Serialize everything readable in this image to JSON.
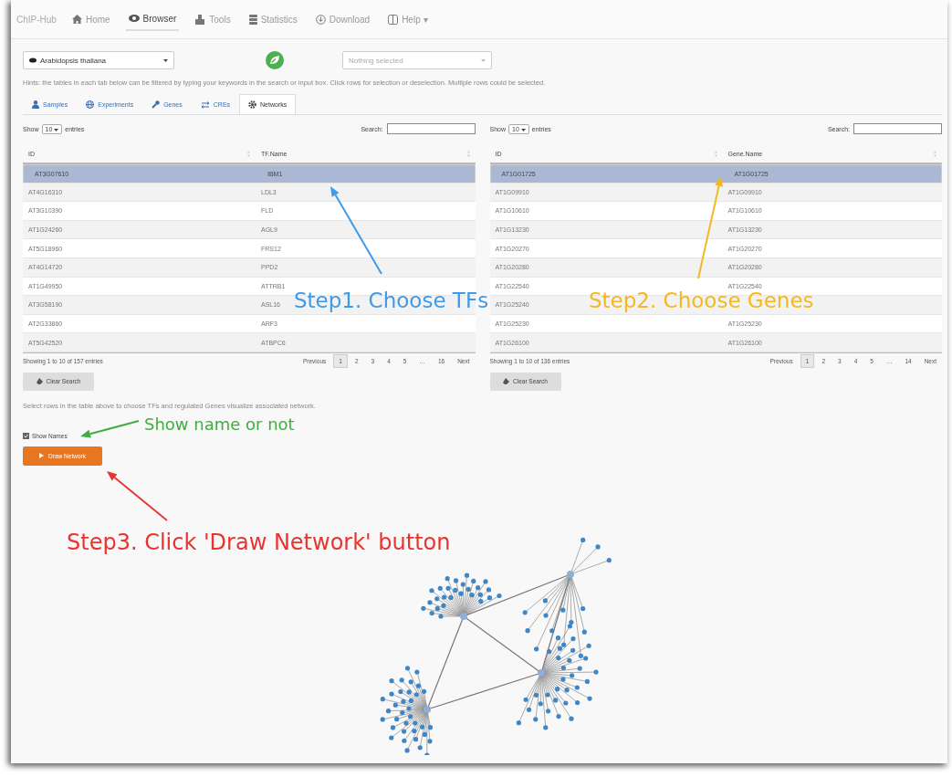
{
  "nav": {
    "brand": "ChIP-Hub",
    "items": [
      {
        "label": "Home",
        "selected": false
      },
      {
        "label": "Browser",
        "selected": true
      },
      {
        "label": "Tools",
        "selected": false
      },
      {
        "label": "Statistics",
        "selected": false
      },
      {
        "label": "Download",
        "selected": false
      },
      {
        "label": "Help",
        "selected": false,
        "caret": "▾"
      }
    ]
  },
  "species_select": {
    "value": "Arabidopsis thaliana"
  },
  "second_select": {
    "placeholder": "Nothing selected"
  },
  "hint": "Hints: the tables in each tab below can be filtered by typing your keywords in the search or input box. Click rows for selection or deselection. Multiple rows could be selected.",
  "tabs": [
    {
      "label": "Samples",
      "selected": false
    },
    {
      "label": "Experiments",
      "selected": false
    },
    {
      "label": "Genes",
      "selected": false
    },
    {
      "label": "CREs",
      "selected": false
    },
    {
      "label": "Networks",
      "selected": true
    }
  ],
  "tables": [
    {
      "show_label": "Show",
      "length": "10",
      "entries_label": "entries",
      "search_label": "Search:",
      "columns": [
        "ID",
        "TF.Name"
      ],
      "rows": [
        {
          "cells": [
            "AT3G07610",
            "IBM1"
          ],
          "selected": true
        },
        {
          "cells": [
            "AT4G16310",
            "LDL3"
          ],
          "selected": false
        },
        {
          "cells": [
            "AT3G10390",
            "FLD"
          ],
          "selected": false
        },
        {
          "cells": [
            "AT1G24260",
            "AGL9"
          ],
          "selected": false
        },
        {
          "cells": [
            "AT5G18960",
            "FRS12"
          ],
          "selected": false
        },
        {
          "cells": [
            "AT4G14720",
            "PPD2"
          ],
          "selected": false
        },
        {
          "cells": [
            "AT1G49950",
            "ATTRB1"
          ],
          "selected": false
        },
        {
          "cells": [
            "AT3G58190",
            "ASL16"
          ],
          "selected": false
        },
        {
          "cells": [
            "AT2G33860",
            "ARF3"
          ],
          "selected": false
        },
        {
          "cells": [
            "AT5G42520",
            "ATBPC6"
          ],
          "selected": false
        }
      ],
      "info": "Showing 1 to 10 of 157 entries",
      "previous": "Previous",
      "next": "Next",
      "pages": [
        {
          "label": "1",
          "selected": true
        },
        {
          "label": "2",
          "selected": false
        },
        {
          "label": "3",
          "selected": false
        },
        {
          "label": "4",
          "selected": false
        },
        {
          "label": "5",
          "selected": false
        },
        {
          "label": "…",
          "selected": false
        },
        {
          "label": "16",
          "selected": false
        }
      ],
      "clear_button": "Clear Search"
    },
    {
      "show_label": "Show",
      "length": "10",
      "entries_label": "entries",
      "search_label": "Search:",
      "columns": [
        "ID",
        "Gene.Name"
      ],
      "rows": [
        {
          "cells": [
            "AT1G01725",
            "AT1G01725"
          ],
          "selected": true
        },
        {
          "cells": [
            "AT1G09910",
            "AT1G09910"
          ],
          "selected": false
        },
        {
          "cells": [
            "AT1G10610",
            "AT1G10610"
          ],
          "selected": false
        },
        {
          "cells": [
            "AT1G13230",
            "AT1G13230"
          ],
          "selected": false
        },
        {
          "cells": [
            "AT1G20270",
            "AT1G20270"
          ],
          "selected": false
        },
        {
          "cells": [
            "AT1G20280",
            "AT1G20280"
          ],
          "selected": false
        },
        {
          "cells": [
            "AT1G22540",
            "AT1G22540"
          ],
          "selected": false
        },
        {
          "cells": [
            "AT1G25240"
          ],
          "selected": false
        },
        {
          "cells": [
            "AT1G25230",
            "AT1G25230"
          ],
          "selected": false
        },
        {
          "cells": [
            "AT1G26100",
            "AT1G26100"
          ],
          "selected": false
        }
      ],
      "info": "Showing 1 to 10 of 136 entries",
      "previous": "Previous",
      "next": "Next",
      "pages": [
        {
          "label": "1",
          "selected": true
        },
        {
          "label": "2",
          "selected": false
        },
        {
          "label": "3",
          "selected": false
        },
        {
          "label": "4",
          "selected": false
        },
        {
          "label": "5",
          "selected": false
        },
        {
          "label": "…",
          "selected": false
        },
        {
          "label": "14",
          "selected": false
        }
      ],
      "clear_button": "Clear Search"
    }
  ],
  "select_note": "Select rows in the table above to choose TFs and regulated Genes visualize associated network.",
  "show_names": {
    "label": "Show Names",
    "checked": true
  },
  "draw_button": "Draw Network",
  "annotations": [
    {
      "text": "Step1. Choose TFs",
      "color": "#3d9be9"
    },
    {
      "text": "Step2. Choose Genes",
      "color": "#f5b820"
    },
    {
      "text": "Show name or not",
      "color": "#3fae3f"
    },
    {
      "text": "Step3. Click 'Draw Network' button",
      "color": "#e8332e"
    }
  ]
}
